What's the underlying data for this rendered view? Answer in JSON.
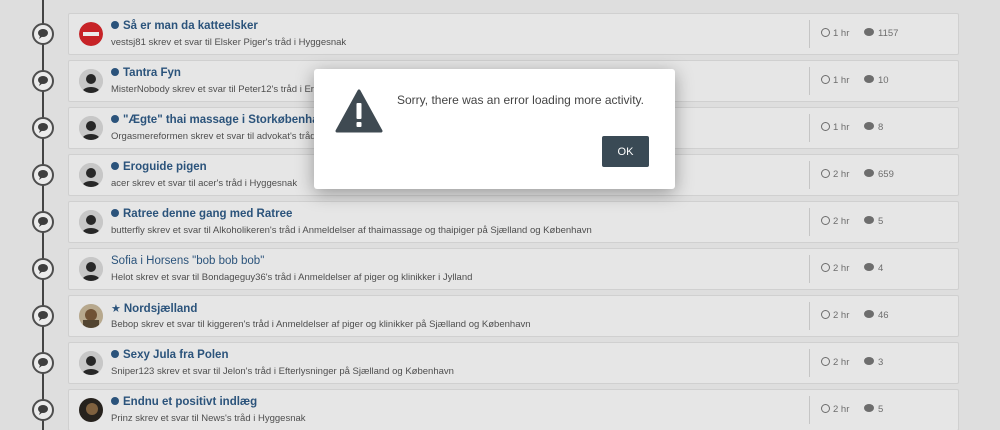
{
  "activity": [
    {
      "title": "Så er man da katteelsker",
      "subtitle": "vestsj81 skrev et svar til Elsker Piger's tråd i Hyggesnak",
      "time": "1 hr",
      "replies": "1157",
      "marker": "dot",
      "bold": true,
      "avatar": "red"
    },
    {
      "title": "Tantra Fyn",
      "subtitle": "MisterNobody skrev et svar til Peter12's tråd i Erfaringer",
      "time": "1 hr",
      "replies": "10",
      "marker": "dot",
      "bold": true,
      "avatar": "default"
    },
    {
      "title": "\"Ægte\" thai massage i Storkøbenhavn",
      "subtitle": "Orgasmereformen skrev et svar til advokat's tråd",
      "time": "1 hr",
      "replies": "8",
      "marker": "dot",
      "bold": true,
      "avatar": "default"
    },
    {
      "title": "Eroguide pigen",
      "subtitle": "acer skrev et svar til acer's tråd i Hyggesnak",
      "time": "2 hr",
      "replies": "659",
      "marker": "dot",
      "bold": true,
      "avatar": "default"
    },
    {
      "title": "Ratree denne gang med Ratree",
      "subtitle": "butterfly skrev et svar til Alkoholikeren's tråd i Anmeldelser af thaimassage og thaipiger på Sjælland og København",
      "time": "2 hr",
      "replies": "5",
      "marker": "dot",
      "bold": true,
      "avatar": "default"
    },
    {
      "title": "Sofia i Horsens \"bob bob bob\"",
      "subtitle": "Helot skrev et svar til Bondageguy36's tråd i Anmeldelser af piger og klinikker i Jylland",
      "time": "2 hr",
      "replies": "4",
      "marker": "none",
      "bold": false,
      "avatar": "default"
    },
    {
      "title": "Nordsjælland",
      "subtitle": "Bebop skrev et svar til kiggeren's tråd i Anmeldelser af piger og klinikker på Sjælland og København",
      "time": "2 hr",
      "replies": "46",
      "marker": "star",
      "bold": true,
      "avatar": "photo"
    },
    {
      "title": "Sexy Jula fra Polen",
      "subtitle": "Sniper123 skrev et svar til Jelon's tråd i Efterlysninger på Sjælland og København",
      "time": "2 hr",
      "replies": "3",
      "marker": "dot",
      "bold": true,
      "avatar": "default"
    },
    {
      "title": "Endnu et positivt indlæg",
      "subtitle": "Prinz skrev et svar til News's tråd i Hyggesnak",
      "time": "2 hr",
      "replies": "5",
      "marker": "dot",
      "bold": true,
      "avatar": "dark"
    }
  ],
  "dialog": {
    "message": "Sorry, there was an error loading more activity.",
    "ok_label": "OK",
    "icon": "warning-icon"
  },
  "colors": {
    "link": "#2f5b86",
    "ok_button": "#3a4a55",
    "warning_icon": "#3f4a52"
  }
}
